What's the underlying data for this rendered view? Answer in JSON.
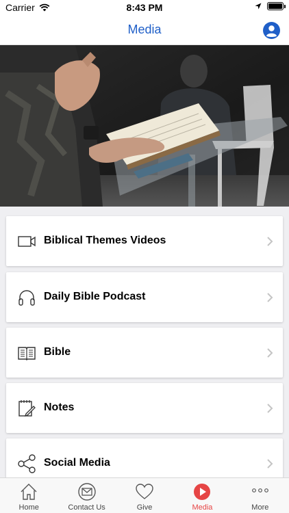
{
  "status_bar": {
    "carrier": "Carrier",
    "time": "8:43 PM"
  },
  "nav": {
    "title": "Media"
  },
  "menu": {
    "items": [
      {
        "label": "Biblical Themes Videos",
        "icon": "video-camera-icon"
      },
      {
        "label": "Daily Bible Podcast",
        "icon": "headphones-icon"
      },
      {
        "label": "Bible",
        "icon": "open-book-icon"
      },
      {
        "label": "Notes",
        "icon": "notepad-pencil-icon"
      },
      {
        "label": "Social Media",
        "icon": "share-icon"
      }
    ]
  },
  "tabs": [
    {
      "label": "Home",
      "icon": "house-icon"
    },
    {
      "label": "Contact Us",
      "icon": "envelope-icon"
    },
    {
      "label": "Give",
      "icon": "heart-icon"
    },
    {
      "label": "Media",
      "icon": "play-icon",
      "active": true
    },
    {
      "label": "More",
      "icon": "ellipsis-icon"
    }
  ],
  "colors": {
    "accent": "#1f5fc8",
    "active_tab": "#e64545"
  }
}
